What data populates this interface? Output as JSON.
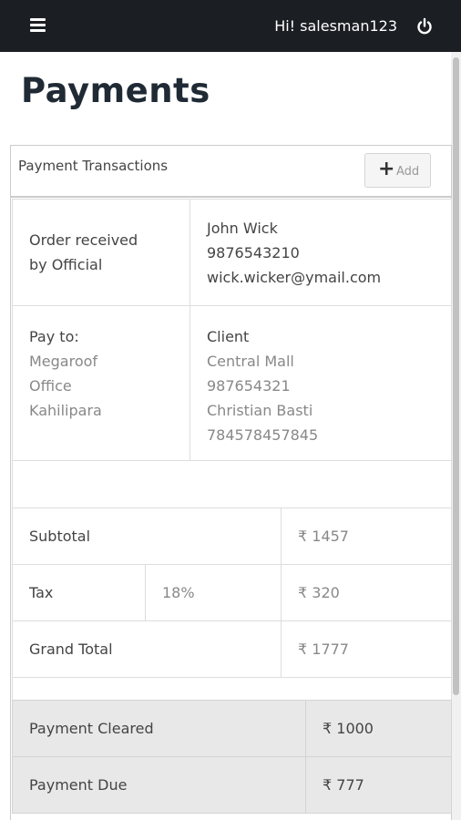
{
  "header": {
    "greeting": "Hi! salesman123",
    "menu_icon": "hamburger-menu-icon",
    "logout_icon": "power-icon",
    "bg_color": "#1b1e22"
  },
  "page": {
    "title": "Payments"
  },
  "panel": {
    "title": "Payment Transactions",
    "add_label": "Add"
  },
  "order": {
    "label_line1": "Order received",
    "label_line2": "by Official",
    "name": "John Wick",
    "phone": "9876543210",
    "email": "wick.wicker@ymail.com"
  },
  "pay_to": {
    "label": "Pay to:",
    "lines": [
      "Megaroof",
      "Office",
      "Kahilipara"
    ]
  },
  "client": {
    "label": "Client",
    "lines": [
      "Central Mall",
      "987654321",
      "Christian Basti",
      "784578457845"
    ]
  },
  "totals": {
    "subtotal_label": "Subtotal",
    "subtotal_value": "₹ 1457",
    "tax_label": "Tax",
    "tax_rate": "18%",
    "tax_value": "₹ 320",
    "grand_total_label": "Grand Total",
    "grand_total_value": "₹ 1777"
  },
  "payments": {
    "cleared_label": "Payment Cleared",
    "cleared_value": "₹ 1000",
    "due_label": "Payment Due",
    "due_value": "₹ 777"
  }
}
